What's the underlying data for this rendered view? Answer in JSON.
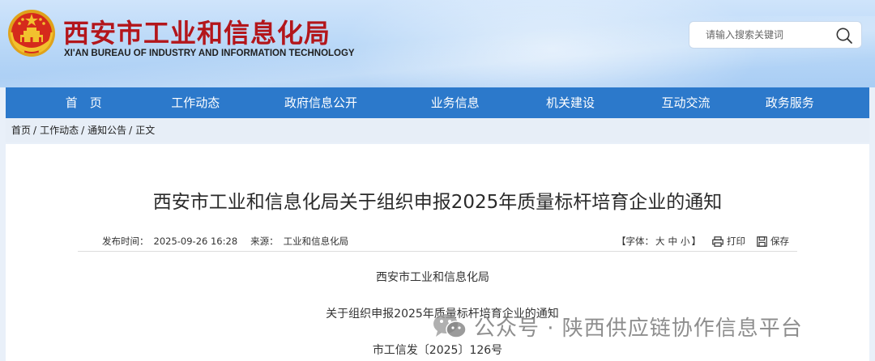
{
  "header": {
    "title": "西安市工业和信息化局",
    "subtitle": "XI'AN BUREAU OF INDUSTRY AND INFORMATION TECHNOLOGY",
    "search_placeholder": "请输入搜索关键词"
  },
  "nav": {
    "items": [
      "首　页",
      "工作动态",
      "政府信息公开",
      "业务信息",
      "机关建设",
      "互动交流",
      "政务服务"
    ]
  },
  "breadcrumb": {
    "items": [
      "首页",
      "工作动态",
      "通知公告",
      "正文"
    ],
    "sep": "/"
  },
  "article": {
    "title": "西安市工业和信息化局关于组织申报2025年质量标杆培育企业的通知",
    "publish_time_label": "发布时间：",
    "publish_time": "2025-09-26 16:28",
    "source_label": "来源：",
    "source": "工业和信息化局",
    "font_size_label": "【字体：",
    "font_large": "大",
    "font_medium": "中",
    "font_small": "小",
    "font_close": "】",
    "print_label": "打印",
    "save_label": "保存",
    "paragraphs": [
      "西安市工业和信息化局",
      "关于组织申报2025年质量标杆培育企业的通知",
      "市工信发〔2025〕126号"
    ]
  },
  "watermark": {
    "text": "公众号 · 陕西供应链协作信息平台"
  },
  "colors": {
    "title_red": "#b3161b",
    "nav_blue": "#2c79cb",
    "header_blue": "#b8d7f7"
  }
}
